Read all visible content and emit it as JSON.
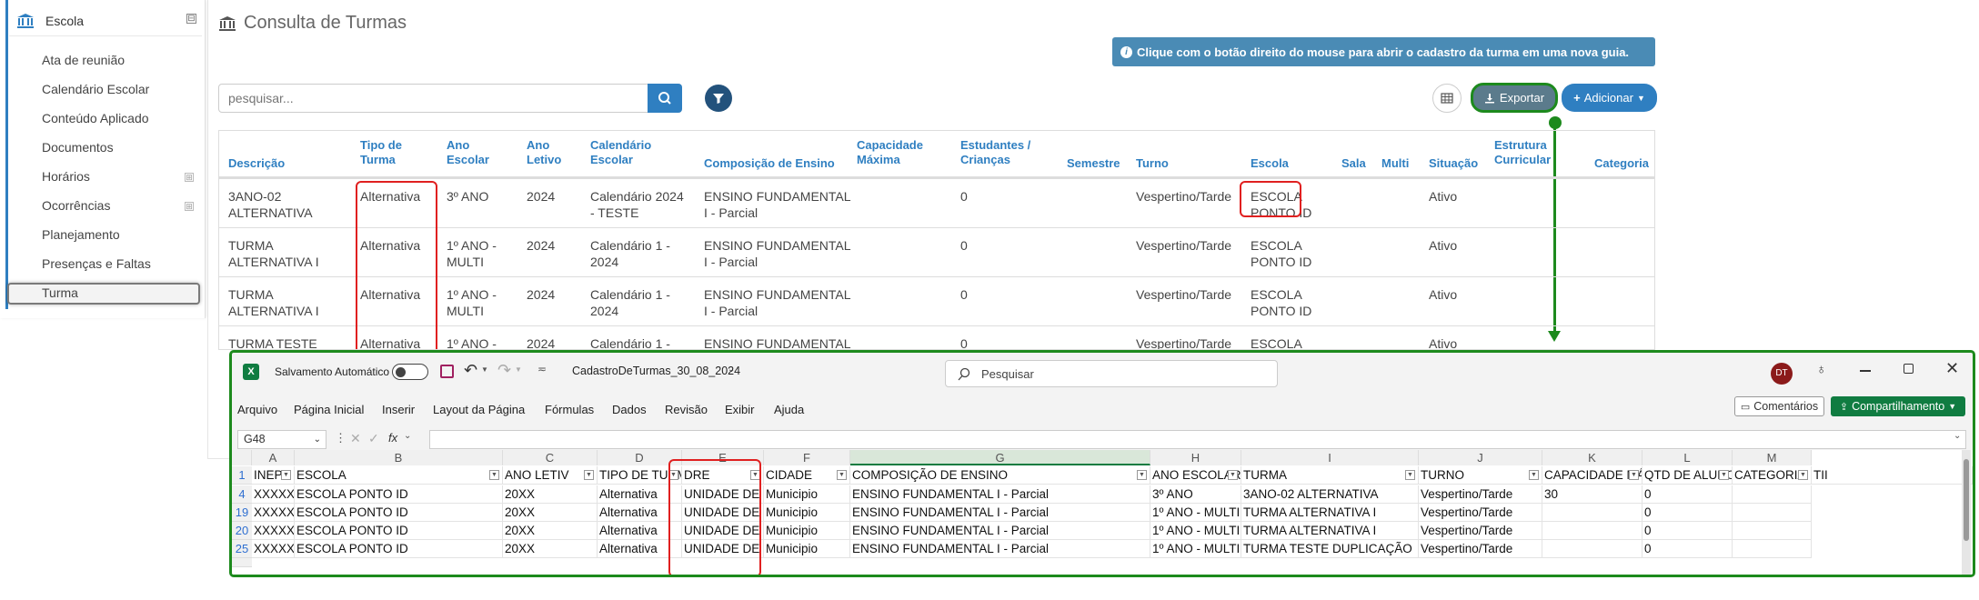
{
  "sidebar": {
    "title": "Escola",
    "collapse_glyph": "⊟",
    "expand_glyph": "⊞",
    "items": [
      {
        "label": "Ata de reunião"
      },
      {
        "label": "Calendário Escolar"
      },
      {
        "label": "Conteúdo Aplicado"
      },
      {
        "label": "Documentos"
      },
      {
        "label": "Horários"
      },
      {
        "label": "Ocorrências"
      },
      {
        "label": "Planejamento"
      },
      {
        "label": "Presenças e Faltas"
      },
      {
        "label": "Turma"
      }
    ]
  },
  "header": {
    "title": "Consulta de Turmas",
    "info": "Clique com o botão direito do mouse para abrir o cadastro da turma em uma nova guia.",
    "info_icon": "i"
  },
  "toolbar": {
    "search_placeholder": "pesquisar...",
    "export_label": "Exportar",
    "add_label": "Adicionar"
  },
  "table": {
    "columns": [
      "Descrição",
      "Tipo de\nTurma",
      "Ano\nEscolar",
      "Ano\nLetivo",
      "Calendário\nEscolar",
      "Composição de Ensino",
      "Capacidade\nMáxima",
      "Estudantes /\nCrianças",
      "Semestre",
      "Turno",
      "Escola",
      "Sala",
      "Multi",
      "Situação",
      "Estrutura\nCurricular",
      "Categoria"
    ],
    "rows": [
      {
        "descricao": "3ANO-02\nALTERNATIVA",
        "tipo": "Alternativa",
        "ano_escolar": "3º ANO",
        "ano_letivo": "2024",
        "calendario": "Calendário 2024\n- TESTE",
        "composicao": "ENSINO FUNDAMENTAL\nI - Parcial",
        "estudantes": "0",
        "turno": "Vespertino/Tarde",
        "escola": "ESCOLA\nPONTO ID",
        "situacao": "Ativo"
      },
      {
        "descricao": "TURMA\nALTERNATIVA I",
        "tipo": "Alternativa",
        "ano_escolar": "1º ANO -\nMULTI",
        "ano_letivo": "2024",
        "calendario": "Calendário 1 -\n2024",
        "composicao": "ENSINO FUNDAMENTAL\nI - Parcial",
        "estudantes": "0",
        "turno": "Vespertino/Tarde",
        "escola": "ESCOLA\nPONTO ID",
        "situacao": "Ativo"
      },
      {
        "descricao": "TURMA\nALTERNATIVA I",
        "tipo": "Alternativa",
        "ano_escolar": "1º ANO -\nMULTI",
        "ano_letivo": "2024",
        "calendario": "Calendário 1 -\n2024",
        "composicao": "ENSINO FUNDAMENTAL\nI - Parcial",
        "estudantes": "0",
        "turno": "Vespertino/Tarde",
        "escola": "ESCOLA\nPONTO ID",
        "situacao": "Ativo"
      },
      {
        "descricao": "TURMA TESTE",
        "tipo": "Alternativa",
        "ano_escolar": "1º ANO -",
        "ano_letivo": "2024",
        "calendario": "Calendário 1 -",
        "composicao": "ENSINO FUNDAMENTAL",
        "estudantes": "0",
        "turno": "Vespertino/Tarde",
        "escola": "ESCOLA",
        "situacao": "Ativo"
      }
    ]
  },
  "excel": {
    "autosave_label": "Salvamento Automático",
    "filename": "CadastroDeTurmas_30_08_2024",
    "search_placeholder": "Pesquisar",
    "avatar": "DT",
    "menu": [
      "Arquivo",
      "Página Inicial",
      "Inserir",
      "Layout da Página",
      "Fórmulas",
      "Dados",
      "Revisão",
      "Exibir",
      "Ajuda"
    ],
    "comments_label": "Comentários",
    "share_label": "Compartilhamento",
    "name_box": "G48",
    "fx_label": "fx",
    "col_letters": [
      "A",
      "B",
      "C",
      "D",
      "E",
      "F",
      "G",
      "H",
      "I",
      "J",
      "K",
      "L",
      "M"
    ],
    "header_row_num": "1",
    "headers": [
      "INEP",
      "ESCOLA",
      "ANO LETIV",
      "TIPO DE TURM",
      "DRE",
      "CIDADE",
      "COMPOSIÇÃO DE ENSINO",
      "ANO ESCOLAR",
      "TURMA",
      "TURNO",
      "CAPACIDADE MÁXIM",
      "QTD DE ALUNO",
      "CATEGORIA",
      "TII"
    ],
    "rows": [
      {
        "num": "4",
        "cells": [
          "XXXXX",
          "ESCOLA PONTO ID",
          "20XX",
          "Alternativa",
          "UNIDADE DE TESTE SECRETARIA",
          "Municipio",
          "ENSINO FUNDAMENTAL I - Parcial",
          "3º ANO",
          "3ANO-02 ALTERNATIVA",
          "Vespertino/Tarde",
          "30",
          "0",
          ""
        ]
      },
      {
        "num": "19",
        "cells": [
          "XXXXX",
          "ESCOLA PONTO ID",
          "20XX",
          "Alternativa",
          "UNIDADE DE TESTE SECRETARIA",
          "Municipio",
          "ENSINO FUNDAMENTAL I - Parcial",
          "1º ANO - MULTI",
          "TURMA ALTERNATIVA I",
          "Vespertino/Tarde",
          "",
          "0",
          ""
        ]
      },
      {
        "num": "20",
        "cells": [
          "XXXXX",
          "ESCOLA PONTO ID",
          "20XX",
          "Alternativa",
          "UNIDADE DE TESTE SECRETARIA",
          "Municipio",
          "ENSINO FUNDAMENTAL I - Parcial",
          "1º ANO - MULTI",
          "TURMA ALTERNATIVA I",
          "Vespertino/Tarde",
          "",
          "0",
          ""
        ]
      },
      {
        "num": "25",
        "cells": [
          "XXXXX",
          "ESCOLA PONTO ID",
          "20XX",
          "Alternativa",
          "UNIDADE DE TESTE SECRETARIA",
          "Municipio",
          "ENSINO FUNDAMENTAL I - Parcial",
          "1º ANO - MULTI",
          "TURMA TESTE DUPLICAÇÃO",
          "Vespertino/Tarde",
          "",
          "0",
          ""
        ]
      }
    ]
  },
  "colors": {
    "accent": "#2f7fc1",
    "highlight_green": "#1d8a1d",
    "highlight_red": "#e02020",
    "excel_green": "#107c41"
  }
}
